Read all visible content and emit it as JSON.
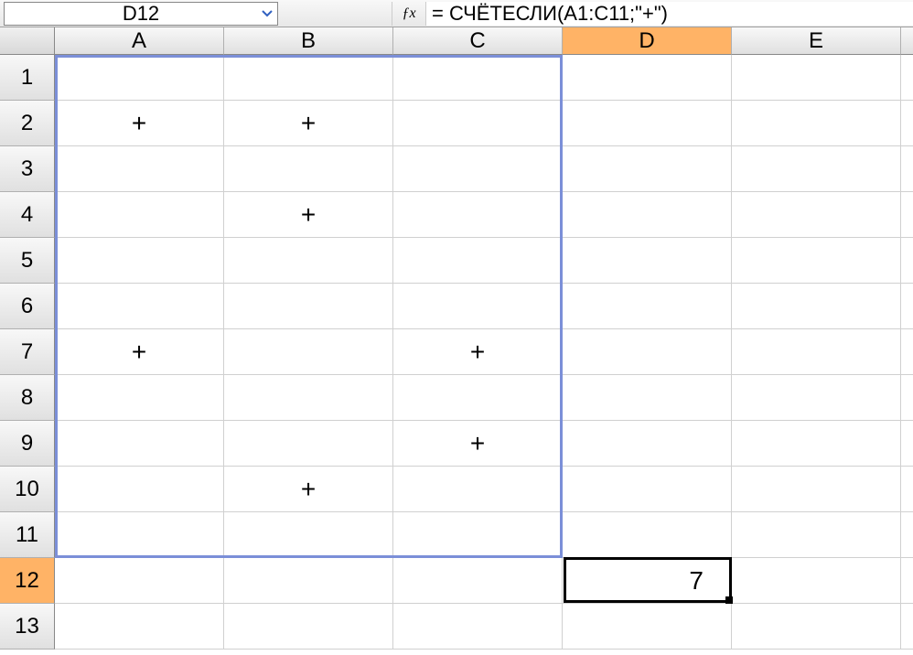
{
  "name_box": {
    "value": "D12"
  },
  "fx_label": "ƒx",
  "formula": {
    "value": "= СЧЁТЕСЛИ(A1:C11;\"+\")"
  },
  "columns": [
    "A",
    "B",
    "C",
    "D",
    "E"
  ],
  "rows": [
    "1",
    "2",
    "3",
    "4",
    "5",
    "6",
    "7",
    "8",
    "9",
    "10",
    "11",
    "12",
    "13"
  ],
  "active_column": "D",
  "active_row": "12",
  "cells": {
    "A2": "+",
    "B2": "+",
    "B4": "+",
    "A7": "+",
    "C7": "+",
    "C9": "+",
    "B10": "+",
    "D12": "7"
  }
}
